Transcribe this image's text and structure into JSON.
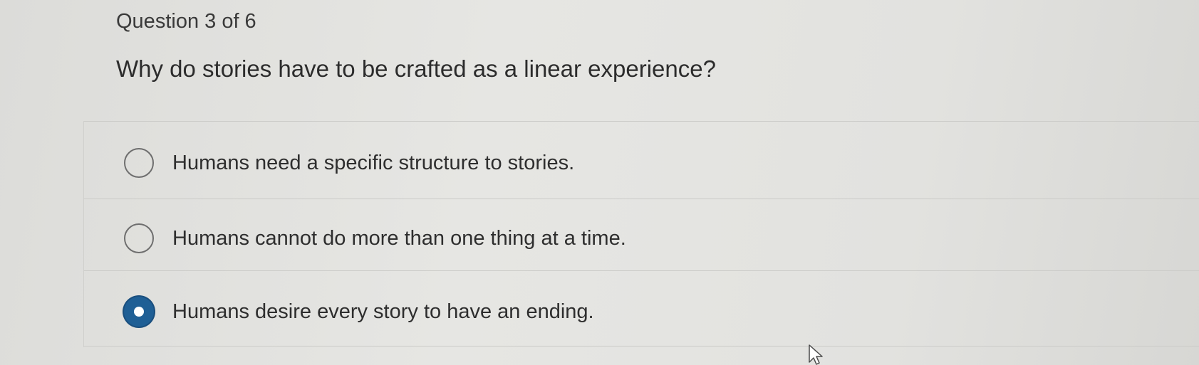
{
  "quiz": {
    "counter": "Question 3 of 6",
    "question": "Why do stories have to be crafted as a linear experience?",
    "options": [
      {
        "label": "Humans need a specific structure to stories.",
        "selected": false
      },
      {
        "label": "Humans cannot do more than one thing at a time.",
        "selected": false
      },
      {
        "label": "Humans desire every story to have an ending.",
        "selected": true
      }
    ]
  },
  "colors": {
    "selected_radio": "#1f5f95",
    "unselected_radio_border": "#6e6e6e"
  }
}
